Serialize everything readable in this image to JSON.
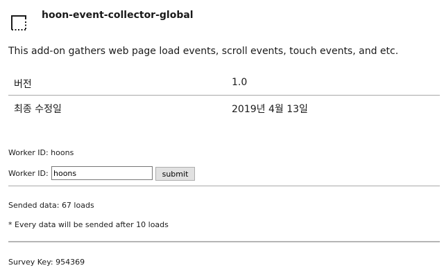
{
  "header": {
    "title": "hoon-event-collector-global",
    "logo_icon": "dotted-frame-icon"
  },
  "description": "This add-on gathers web page load events, scroll events, touch events, and etc.",
  "info": {
    "version_label": "버전",
    "version_value": "1.0",
    "updated_label": "최종 수정일",
    "updated_value": "2019년 4월 13일"
  },
  "worker": {
    "display_prefix": "Worker ID: ",
    "display_value": "hoons",
    "form_label": "Worker ID:",
    "input_value": "hoons",
    "submit_label": "submit"
  },
  "stats": {
    "sended_prefix": "Sended data: ",
    "sended_value": "67 loads",
    "notice": "* Every data will be sended after 10 loads"
  },
  "survey": {
    "prefix": "Survey Key: ",
    "value": "954369"
  }
}
